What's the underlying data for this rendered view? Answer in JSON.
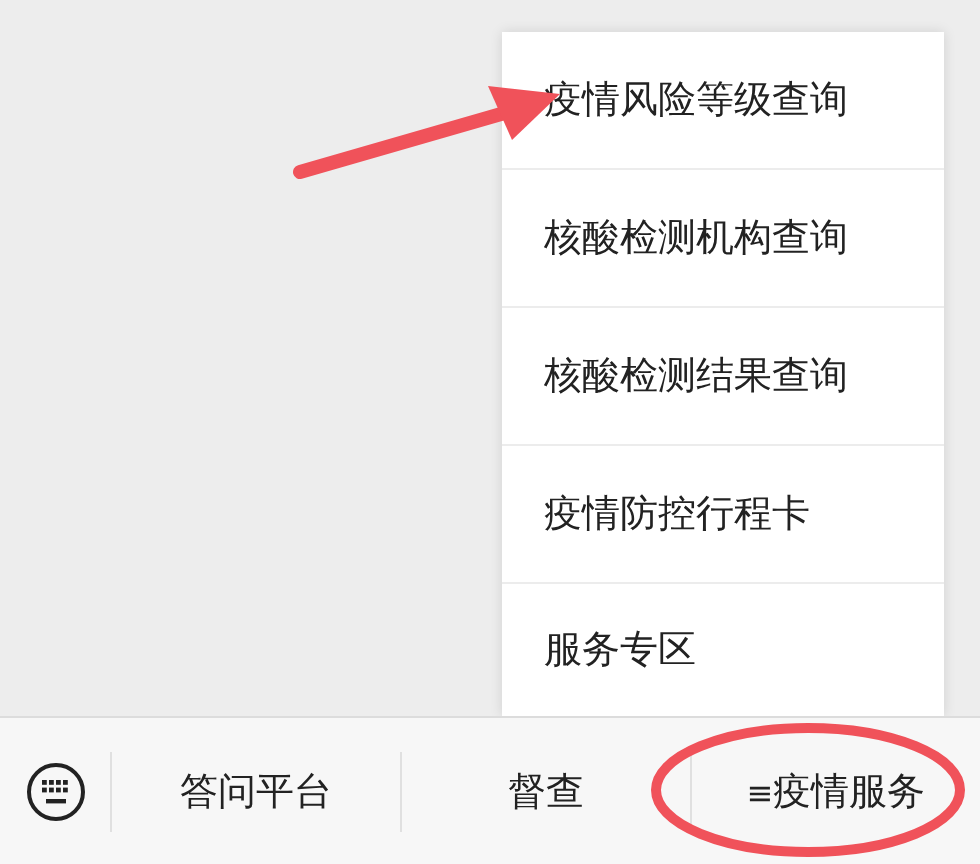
{
  "popup_menu": {
    "items": [
      {
        "label": "疫情风险等级查询"
      },
      {
        "label": "核酸检测机构查询"
      },
      {
        "label": "核酸检测结果查询"
      },
      {
        "label": "疫情防控行程卡"
      },
      {
        "label": "服务专区"
      }
    ]
  },
  "bottom_menu": {
    "tabs": [
      {
        "label": "答问平台"
      },
      {
        "label": "督查"
      },
      {
        "marker": "≡",
        "label": "疫情服务"
      }
    ]
  }
}
